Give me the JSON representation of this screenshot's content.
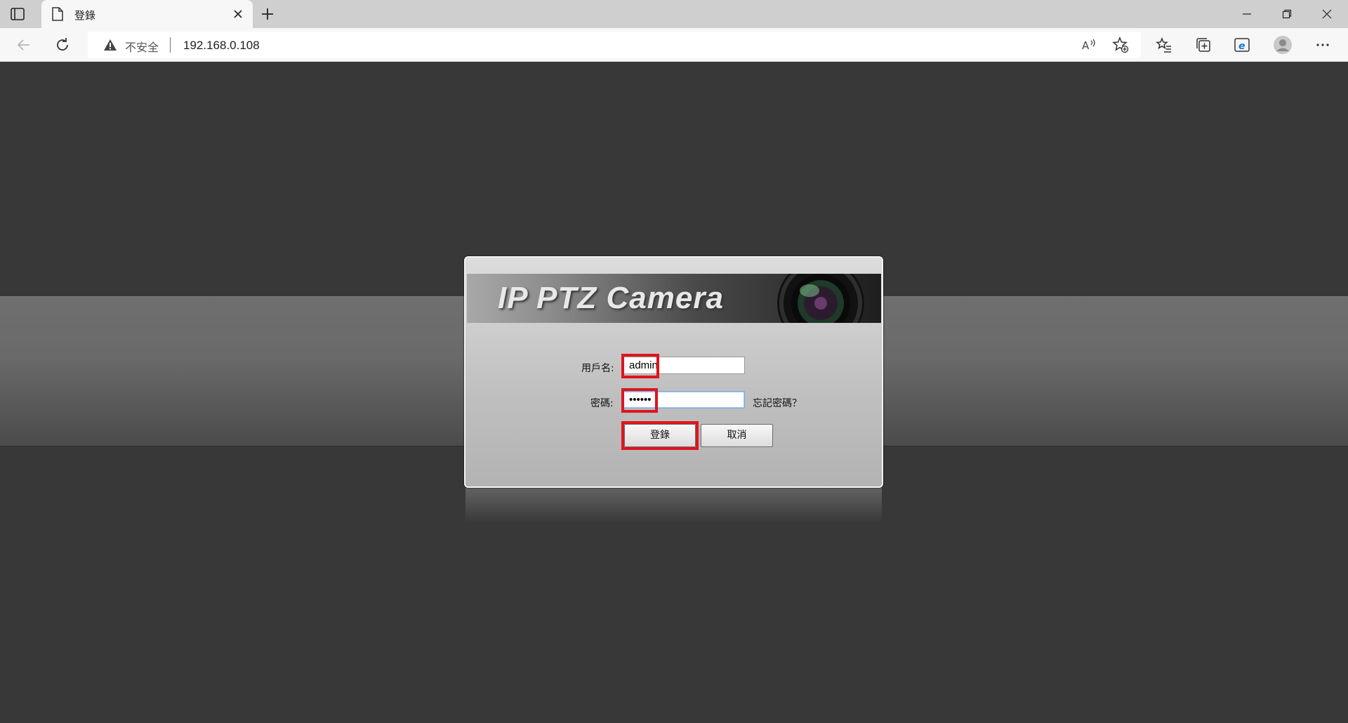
{
  "browser": {
    "tab_title": "登錄",
    "security_label": "不安全",
    "url": "192.168.0.108"
  },
  "login": {
    "banner_title": "IP PTZ Camera",
    "username_label": "用戶名:",
    "username_value": "admin",
    "password_label": "密碼:",
    "password_value": "••••••",
    "forgot_password": "忘記密碼？",
    "login_button": "登錄",
    "cancel_button": "取消"
  },
  "colors": {
    "page_background": "#383838",
    "highlight": "#e0141e"
  }
}
